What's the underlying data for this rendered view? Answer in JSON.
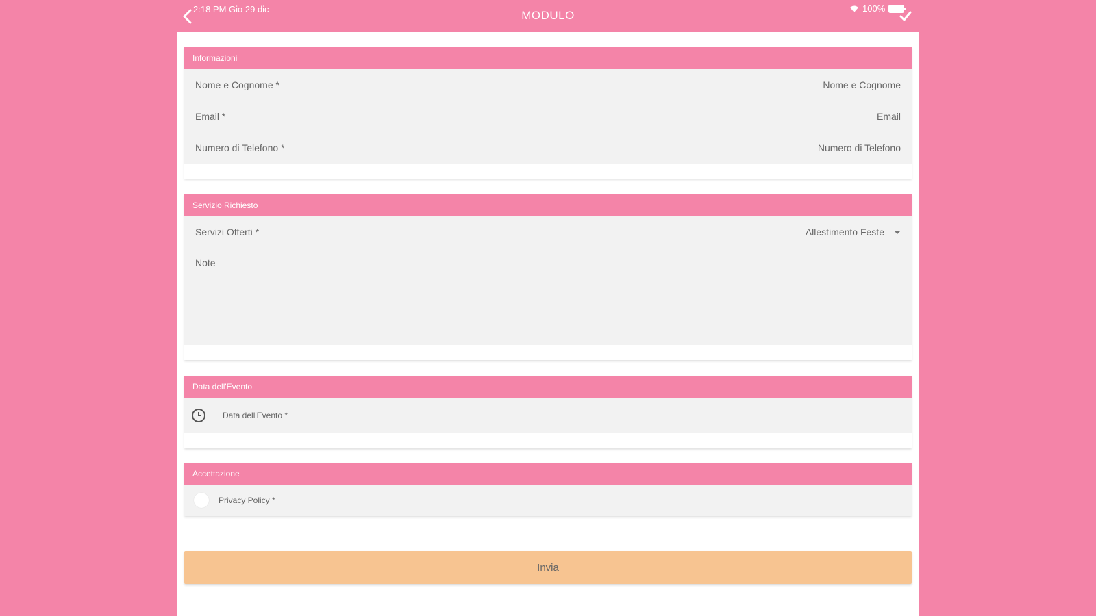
{
  "status_bar": {
    "time": "2:18 PM   Gio 29 dic",
    "battery": "100%"
  },
  "nav": {
    "title": "MODULO"
  },
  "sections": {
    "informazioni": {
      "header": "Informazioni",
      "name_label": "Nome e Cognome *",
      "name_placeholder": "Nome e Cognome",
      "email_label": "Email *",
      "email_placeholder": "Email",
      "phone_label": "Numero di Telefono *",
      "phone_placeholder": "Numero di Telefono"
    },
    "servizio": {
      "header": "Servizio Richiesto",
      "services_label": "Servizi Offerti *",
      "services_value": "Allestimento Feste",
      "notes_label": "Note"
    },
    "data_evento": {
      "header": "Data dell'Evento",
      "date_label": "Data dell'Evento *"
    },
    "accettazione": {
      "header": "Accettazione",
      "privacy_label": "Privacy Policy *"
    }
  },
  "submit_label": "Invia",
  "colors": {
    "accent": "#f484a8",
    "button": "#f7c491",
    "field_bg": "#f2f2f2"
  },
  "icons": [
    "back-icon",
    "wifi-icon",
    "battery-icon",
    "check-icon",
    "caret-down-icon",
    "clock-icon"
  ]
}
